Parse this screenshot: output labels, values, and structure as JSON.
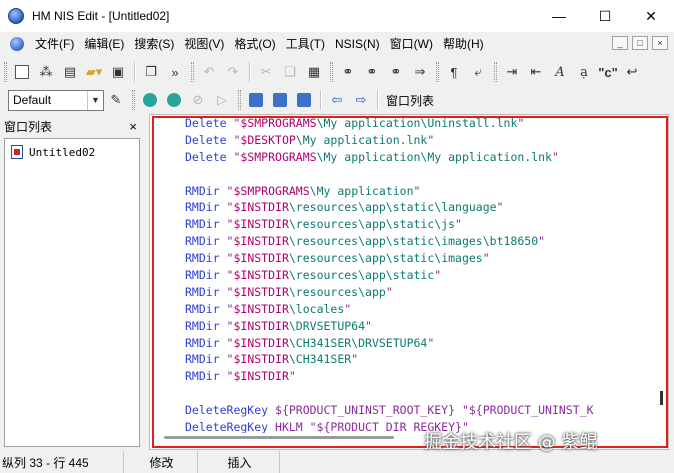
{
  "window": {
    "title": "HM NIS Edit - [Untitled02]",
    "controls": [
      "—",
      "☐",
      "✕"
    ]
  },
  "menubar": {
    "items": [
      "文件(F)",
      "编辑(E)",
      "搜索(S)",
      "视图(V)",
      "格式(O)",
      "工具(T)",
      "NSIS(N)",
      "窗口(W)",
      "帮助(H)"
    ],
    "mdi_controls": [
      "_",
      "□",
      "×"
    ]
  },
  "toolbar2": {
    "scheme_value": "Default",
    "window_list_label": "窗口列表"
  },
  "left_panel": {
    "title": "窗口列表",
    "close": "×",
    "items": [
      "Untitled02"
    ]
  },
  "editor": {
    "lines": [
      [
        {
          "t": "Delete ",
          "c": "kw"
        },
        {
          "t": "\"",
          "c": "str"
        },
        {
          "t": "$SMPROGRAMS",
          "c": "var"
        },
        {
          "t": "\\My application\\Uninstall.lnk",
          "c": "plain"
        },
        {
          "t": "\"",
          "c": "str"
        }
      ],
      [
        {
          "t": "Delete ",
          "c": "kw"
        },
        {
          "t": "\"",
          "c": "str"
        },
        {
          "t": "$DESKTOP",
          "c": "var"
        },
        {
          "t": "\\My application.lnk",
          "c": "plain"
        },
        {
          "t": "\"",
          "c": "str"
        }
      ],
      [
        {
          "t": "Delete ",
          "c": "kw"
        },
        {
          "t": "\"",
          "c": "str"
        },
        {
          "t": "$SMPROGRAMS",
          "c": "var"
        },
        {
          "t": "\\My application\\My application.lnk",
          "c": "plain"
        },
        {
          "t": "\"",
          "c": "str"
        }
      ],
      [],
      [
        {
          "t": "RMDir ",
          "c": "kw"
        },
        {
          "t": "\"",
          "c": "str"
        },
        {
          "t": "$SMPROGRAMS",
          "c": "var"
        },
        {
          "t": "\\My application",
          "c": "plain"
        },
        {
          "t": "\"",
          "c": "str"
        }
      ],
      [
        {
          "t": "RMDir ",
          "c": "kw"
        },
        {
          "t": "\"",
          "c": "str"
        },
        {
          "t": "$INSTDIR",
          "c": "var"
        },
        {
          "t": "\\resources\\app\\static\\language",
          "c": "plain"
        },
        {
          "t": "\"",
          "c": "str"
        }
      ],
      [
        {
          "t": "RMDir ",
          "c": "kw"
        },
        {
          "t": "\"",
          "c": "str"
        },
        {
          "t": "$INSTDIR",
          "c": "var"
        },
        {
          "t": "\\resources\\app\\static\\js",
          "c": "plain"
        },
        {
          "t": "\"",
          "c": "str"
        }
      ],
      [
        {
          "t": "RMDir ",
          "c": "kw"
        },
        {
          "t": "\"",
          "c": "str"
        },
        {
          "t": "$INSTDIR",
          "c": "var"
        },
        {
          "t": "\\resources\\app\\static\\images\\bt18650",
          "c": "plain"
        },
        {
          "t": "\"",
          "c": "str"
        }
      ],
      [
        {
          "t": "RMDir ",
          "c": "kw"
        },
        {
          "t": "\"",
          "c": "str"
        },
        {
          "t": "$INSTDIR",
          "c": "var"
        },
        {
          "t": "\\resources\\app\\static\\images",
          "c": "plain"
        },
        {
          "t": "\"",
          "c": "str"
        }
      ],
      [
        {
          "t": "RMDir ",
          "c": "kw"
        },
        {
          "t": "\"",
          "c": "str"
        },
        {
          "t": "$INSTDIR",
          "c": "var"
        },
        {
          "t": "\\resources\\app\\static",
          "c": "plain"
        },
        {
          "t": "\"",
          "c": "str"
        }
      ],
      [
        {
          "t": "RMDir ",
          "c": "kw"
        },
        {
          "t": "\"",
          "c": "str"
        },
        {
          "t": "$INSTDIR",
          "c": "var"
        },
        {
          "t": "\\resources\\app",
          "c": "plain"
        },
        {
          "t": "\"",
          "c": "str"
        }
      ],
      [
        {
          "t": "RMDir ",
          "c": "kw"
        },
        {
          "t": "\"",
          "c": "str"
        },
        {
          "t": "$INSTDIR",
          "c": "var"
        },
        {
          "t": "\\locales",
          "c": "plain"
        },
        {
          "t": "\"",
          "c": "str"
        }
      ],
      [
        {
          "t": "RMDir ",
          "c": "kw"
        },
        {
          "t": "\"",
          "c": "str"
        },
        {
          "t": "$INSTDIR",
          "c": "var"
        },
        {
          "t": "\\DRVSETUP64",
          "c": "plain"
        },
        {
          "t": "\"",
          "c": "str"
        }
      ],
      [
        {
          "t": "RMDir ",
          "c": "kw"
        },
        {
          "t": "\"",
          "c": "str"
        },
        {
          "t": "$INSTDIR",
          "c": "var"
        },
        {
          "t": "\\CH341SER\\DRVSETUP64",
          "c": "plain"
        },
        {
          "t": "\"",
          "c": "str"
        }
      ],
      [
        {
          "t": "RMDir ",
          "c": "kw"
        },
        {
          "t": "\"",
          "c": "str"
        },
        {
          "t": "$INSTDIR",
          "c": "var"
        },
        {
          "t": "\\CH341SER",
          "c": "plain"
        },
        {
          "t": "\"",
          "c": "str"
        }
      ],
      [
        {
          "t": "RMDir ",
          "c": "kw"
        },
        {
          "t": "\"",
          "c": "str"
        },
        {
          "t": "$INSTDIR",
          "c": "var"
        },
        {
          "t": "\"",
          "c": "str"
        }
      ],
      [],
      [
        {
          "t": "DeleteRegKey ",
          "c": "kw"
        },
        {
          "t": "${PRODUCT_UNINST_ROOT_KEY} \"${PRODUCT_UNINST_K",
          "c": "str"
        }
      ],
      [
        {
          "t": "DeleteRegKey ",
          "c": "kw"
        },
        {
          "t": "HKLM \"${PRODUCT_DIR_REGKEY}\"",
          "c": "str"
        }
      ]
    ]
  },
  "status": {
    "position": "纵列 33 - 行 445",
    "modified": "修改",
    "insert_mode": "插入"
  },
  "watermark": "掘金技术社区 @ 紫鲲",
  "colors": {
    "highlight_border": "#e0201e",
    "keyword": "#2f3ed6",
    "string": "#8a2b9e",
    "variable": "#b0006e",
    "path": "#0d7a6f"
  }
}
